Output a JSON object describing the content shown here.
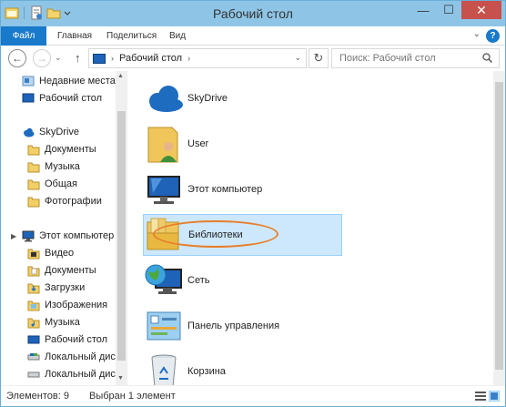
{
  "window": {
    "title": "Рабочий стол",
    "minimize": "—",
    "maximize": "☐",
    "close": "✕"
  },
  "ribbon": {
    "tabs": [
      "Файл",
      "Главная",
      "Поделиться",
      "Вид"
    ],
    "help": "?",
    "collapse": "⌄"
  },
  "address": {
    "back": "←",
    "forward": "→",
    "up": "↑",
    "path": "Рабочий стол",
    "path_arrow": "›",
    "dropdown": "⌄",
    "refresh": "↻",
    "search_placeholder": "Поиск: Рабочий стол"
  },
  "sidebar": {
    "favorites": [
      {
        "label": "Недавние места",
        "icon": "recent-places-icon"
      },
      {
        "label": "Рабочий стол",
        "icon": "desktop-icon"
      }
    ],
    "skydrive": {
      "label": "SkyDrive",
      "icon": "skydrive-icon",
      "children": [
        {
          "label": "Документы",
          "icon": "folder-icon"
        },
        {
          "label": "Музыка",
          "icon": "folder-icon"
        },
        {
          "label": "Общая",
          "icon": "folder-icon"
        },
        {
          "label": "Фотографии",
          "icon": "folder-icon"
        }
      ]
    },
    "computer": {
      "label": "Этот компьютер",
      "icon": "computer-icon",
      "children": [
        {
          "label": "Видео",
          "icon": "videos-folder-icon"
        },
        {
          "label": "Документы",
          "icon": "documents-folder-icon"
        },
        {
          "label": "Загрузки",
          "icon": "downloads-folder-icon"
        },
        {
          "label": "Изображения",
          "icon": "pictures-folder-icon"
        },
        {
          "label": "Музыка",
          "icon": "music-folder-icon"
        },
        {
          "label": "Рабочий стол",
          "icon": "desktop-folder-icon"
        },
        {
          "label": "Локальный диск",
          "icon": "local-disk-icon"
        },
        {
          "label": "Локальный диск",
          "icon": "local-disk-icon"
        }
      ]
    }
  },
  "items": [
    {
      "label": "SkyDrive",
      "icon": "skydrive-icon"
    },
    {
      "label": "User",
      "icon": "user-folder-icon"
    },
    {
      "label": "Этот компьютер",
      "icon": "computer-icon"
    },
    {
      "label": "Библиотеки",
      "icon": "libraries-icon",
      "selected": true
    },
    {
      "label": "Сеть",
      "icon": "network-icon"
    },
    {
      "label": "Панель управления",
      "icon": "control-panel-icon"
    },
    {
      "label": "Корзина",
      "icon": "recycle-bin-icon"
    }
  ],
  "status": {
    "count": "Элементов: 9",
    "selected": "Выбран 1 элемент"
  },
  "colors": {
    "titlebar": "#8ec5e6",
    "file_tab": "#1979ca",
    "selection": "#cde8fc",
    "highlight_oval": "#e87e2c"
  }
}
